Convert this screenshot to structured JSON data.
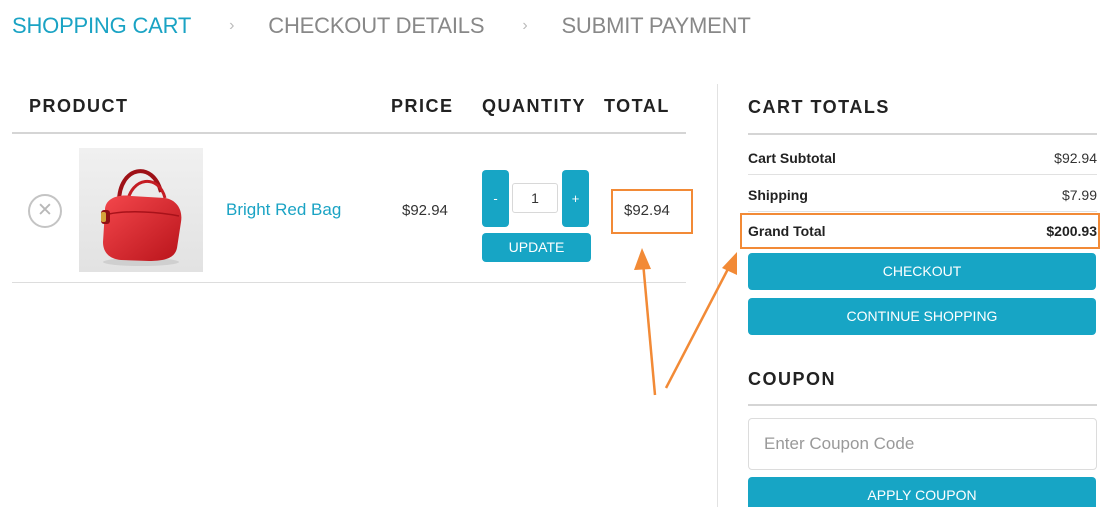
{
  "steps": [
    {
      "label": "SHOPPING CART",
      "active": true
    },
    {
      "label": "CHECKOUT DETAILS",
      "active": false
    },
    {
      "label": "SUBMIT PAYMENT",
      "active": false
    }
  ],
  "step_separator": "›",
  "cart": {
    "columns": {
      "product": "PRODUCT",
      "price": "PRICE",
      "quantity": "QUANTITY",
      "total": "TOTAL"
    },
    "item": {
      "remove_glyph": "✕",
      "image_icon": "red-handbag-icon",
      "name": "Bright Red Bag",
      "price": "$92.94",
      "quantity": "1",
      "minus_label": "-",
      "plus_label": "+",
      "update_label": "UPDATE",
      "line_total": "$92.94"
    }
  },
  "totals": {
    "title": "CART TOTALS",
    "subtotal_label": "Cart Subtotal",
    "subtotal_value": "$92.94",
    "shipping_label": "Shipping",
    "shipping_value": "$7.99",
    "grand_label": "Grand Total",
    "grand_value": "$200.93",
    "checkout_label": "CHECKOUT",
    "continue_label": "CONTINUE SHOPPING"
  },
  "coupon": {
    "title": "COUPON",
    "placeholder": "Enter Coupon Code",
    "apply_label": "APPLY COUPON"
  },
  "colors": {
    "accent": "#17a5c5",
    "link": "#1aa3c4",
    "highlight": "#f28a36",
    "bag": "#e8262d"
  }
}
